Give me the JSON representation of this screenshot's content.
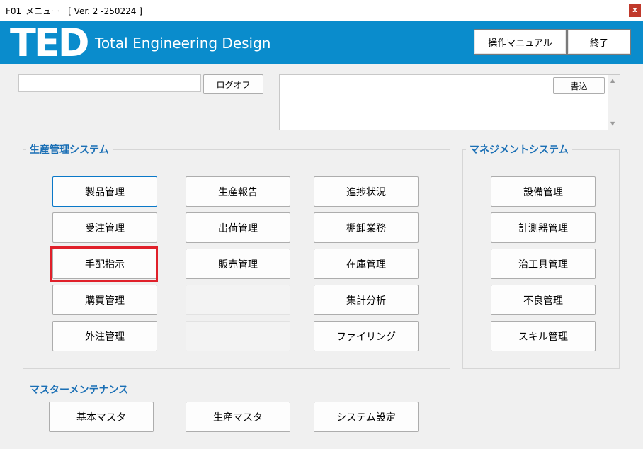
{
  "window": {
    "title": "F01_メニュー　[ Ver. 2 -250224 ]",
    "close_label": "x"
  },
  "header": {
    "logo": "TED",
    "tagline": "Total Engineering Design",
    "manual_button": "操作マニュアル",
    "exit_button": "終了"
  },
  "login": {
    "user_code": "",
    "user_name": "",
    "logoff_button": "ログオフ"
  },
  "memo": {
    "write_button": "書込",
    "text": ""
  },
  "production_system": {
    "label": "生産管理システム",
    "buttons": [
      "製品管理",
      "受注管理",
      "手配指示",
      "購買管理",
      "外注管理",
      "生産報告",
      "出荷管理",
      "販売管理",
      "",
      "",
      "進捗状況",
      "棚卸業務",
      "在庫管理",
      "集計分析",
      "ファイリング"
    ]
  },
  "management_system": {
    "label": "マネジメントシステム",
    "buttons": [
      "設備管理",
      "計測器管理",
      "治工具管理",
      "不良管理",
      "スキル管理"
    ]
  },
  "master_maintenance": {
    "label": "マスターメンテナンス",
    "buttons": [
      "基本マスタ",
      "生産マスタ",
      "システム設定"
    ]
  },
  "colors": {
    "header": "#0a8ccc",
    "group_label": "#1a6fb5",
    "highlight": "#e0202a"
  },
  "icons": {
    "scroll_up": "▲",
    "scroll_down": "▼"
  }
}
